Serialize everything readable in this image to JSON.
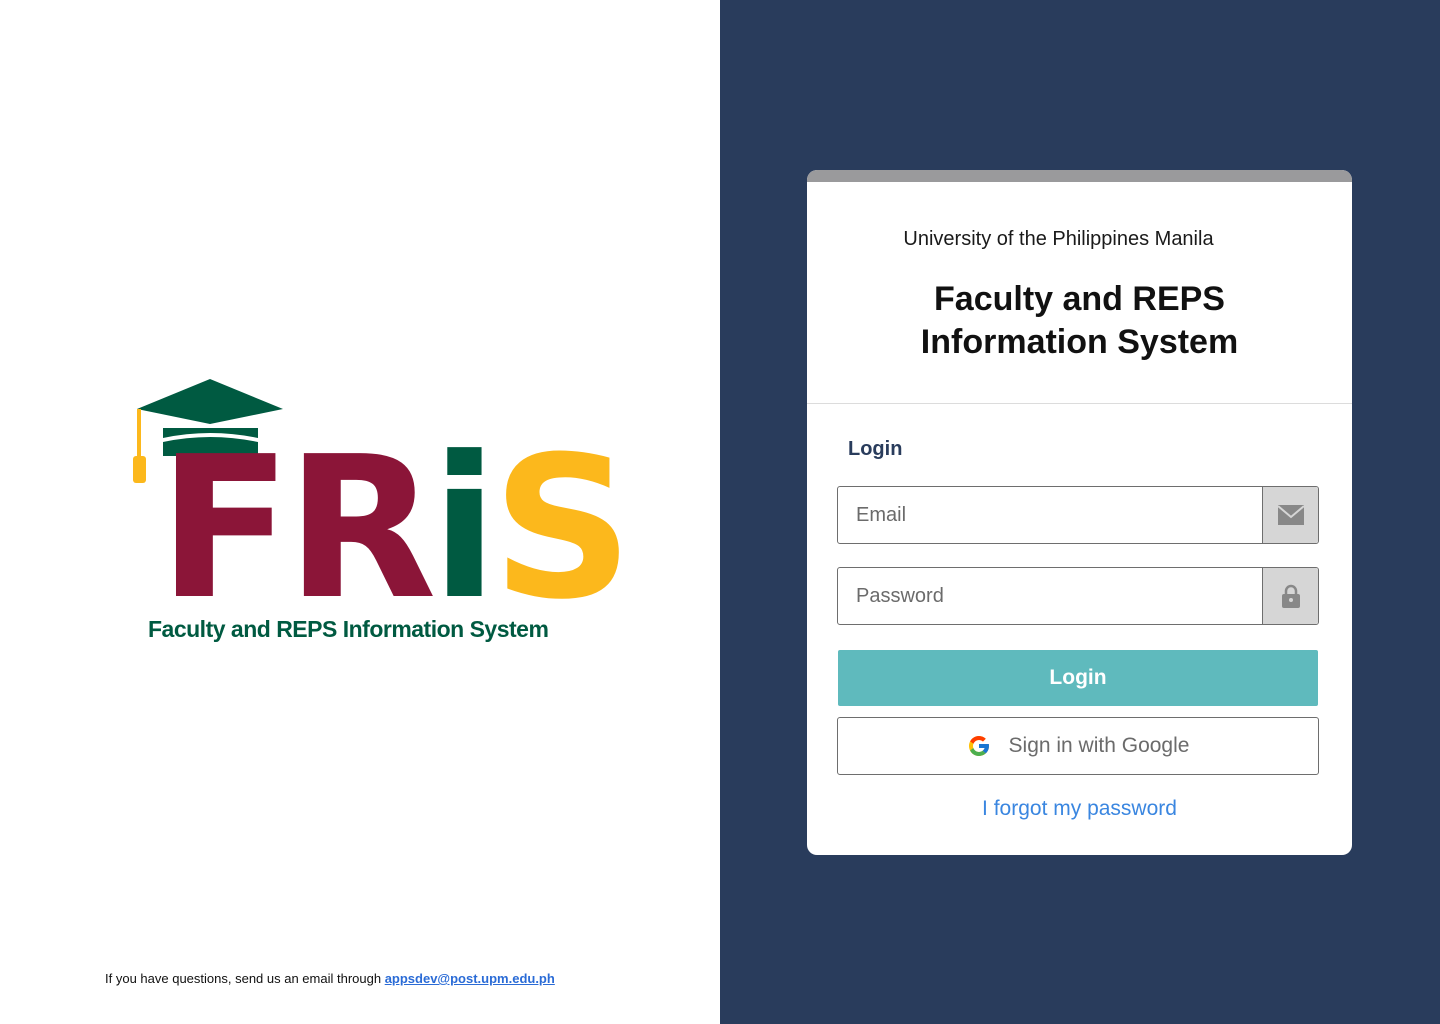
{
  "logo": {
    "wordmark": {
      "f": "F",
      "r": "R",
      "i": "i",
      "s": "S"
    },
    "subtitle": "Faculty and REPS Information System",
    "colors": {
      "maroon": "#8b1538",
      "green": "#005a41",
      "gold": "#fcb81c"
    }
  },
  "footer": {
    "text": "If you have questions, send us an email through ",
    "email": "appsdev@post.upm.edu.ph"
  },
  "card": {
    "university": "University of the Philippines Manila",
    "title_line1": "Faculty and REPS",
    "title_line2": "Information System",
    "login_heading": "Login",
    "email_placeholder": "Email",
    "password_placeholder": "Password",
    "login_button": "Login",
    "google_button": "Sign in with Google",
    "forgot_link": "I forgot my password"
  },
  "icons": {
    "email": "envelope-icon",
    "password": "lock-icon",
    "google": "google-icon",
    "logo_cap": "graduation-cap-icon"
  },
  "colors": {
    "navy": "#293c5c",
    "teal": "#5fbabd",
    "link": "#3a86e0"
  }
}
